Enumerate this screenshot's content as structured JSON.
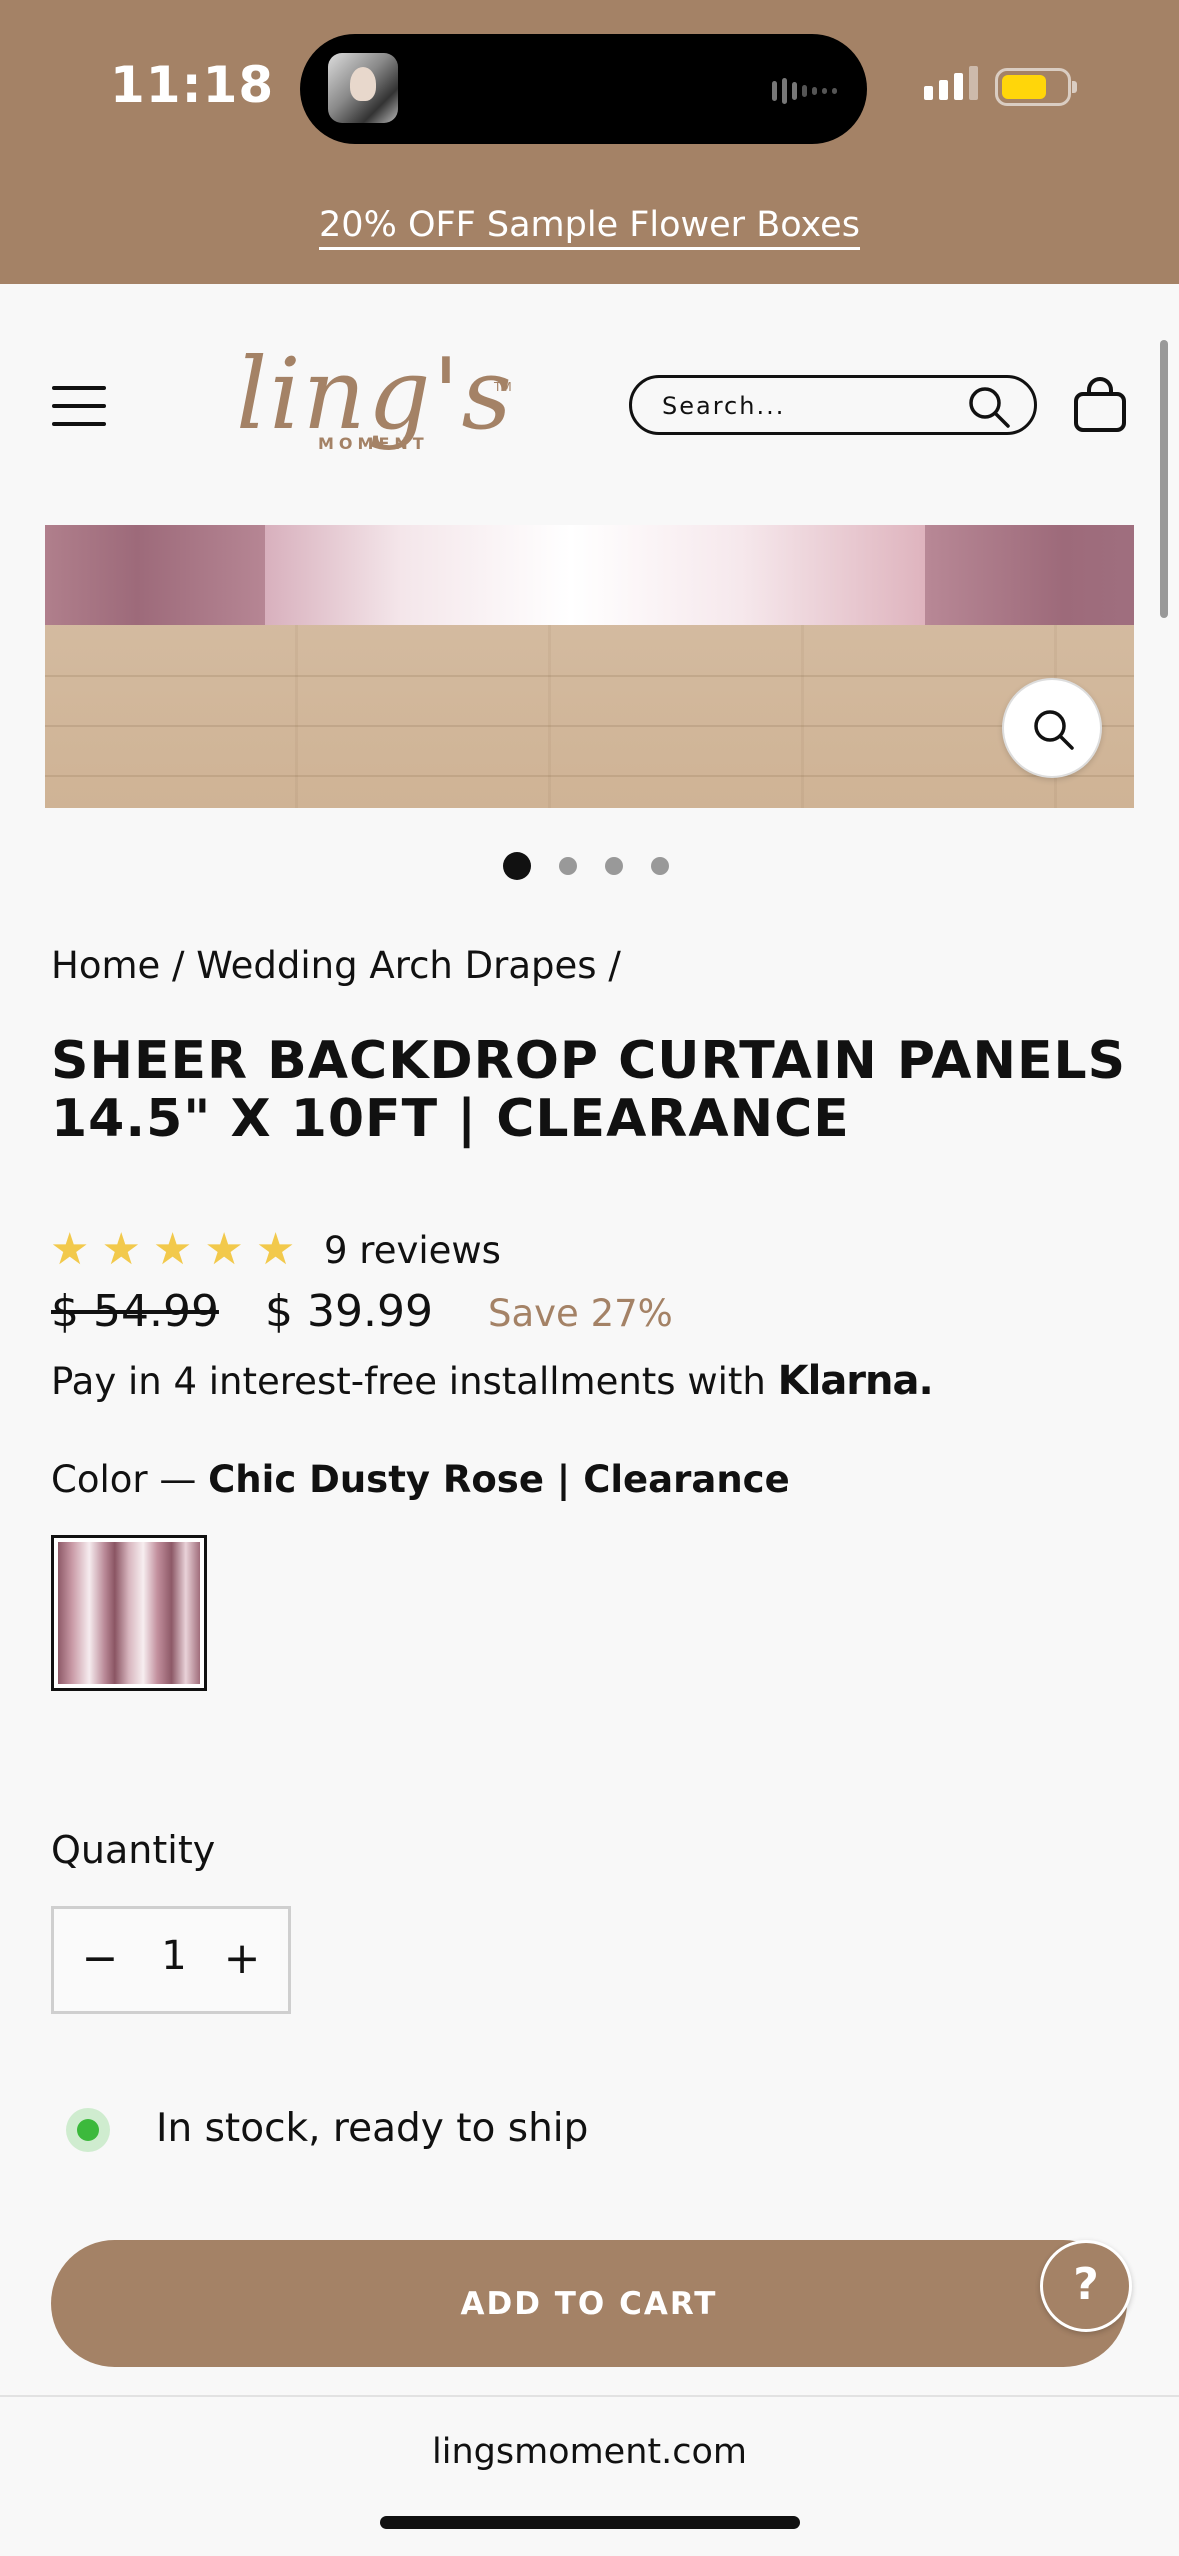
{
  "status_bar": {
    "time": "11:18",
    "battery_color": "#ffd60a"
  },
  "promo": {
    "text": "20% OFF Sample Flower Boxes"
  },
  "header": {
    "logo_text": "ling's",
    "logo_subtext": "MOMENT",
    "logo_tm": "TM",
    "search_placeholder": "Search..."
  },
  "gallery": {
    "slide_count": 4,
    "active_slide": 1
  },
  "breadcrumb": "Home / Wedding Arch Drapes /",
  "product": {
    "title": "SHEER BACKDROP CURTAIN PANELS 14.5\" X 10FT | CLEARANCE",
    "rating_stars": 5,
    "reviews": "9 reviews",
    "old_price": "$ 54.99",
    "price": "$ 39.99",
    "save": "Save 27%",
    "klarna_prefix": "Pay in 4 interest-free installments with",
    "klarna_brand": "Klarna.",
    "color_label": "Color —",
    "color_value": "Chic Dusty Rose | Clearance",
    "quantity_label": "Quantity",
    "quantity_value": "1",
    "minus": "−",
    "plus": "+",
    "stock_text": "In stock, ready to ship",
    "add_to_cart": "ADD TO CART",
    "help": "?"
  },
  "browser": {
    "url": "lingsmoment.com"
  },
  "colors": {
    "brand": "#a48266",
    "star": "#f2c94c",
    "stock_green": "#3cb93c"
  }
}
